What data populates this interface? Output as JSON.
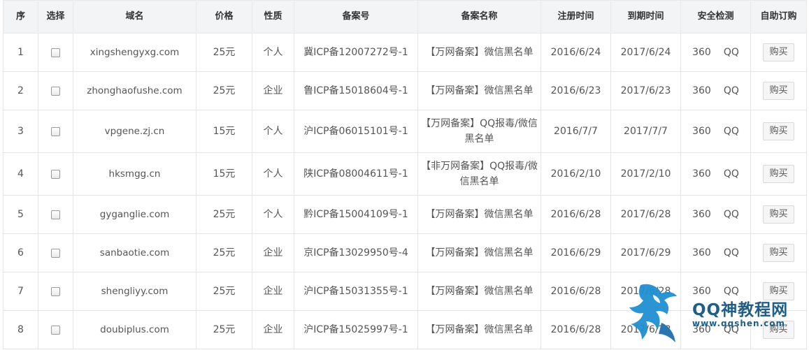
{
  "table": {
    "headers": [
      "序",
      "选择",
      "域名",
      "价格",
      "性质",
      "备案号",
      "备案名称",
      "注册时间",
      "到期时间",
      "安全检测",
      "自助订购"
    ],
    "rows": [
      {
        "no": "1",
        "domain": "xingshengyxg.com",
        "price": "25元",
        "type": "个人",
        "icp": "冀ICP备12007272号-1",
        "name": "【万网备案】微信黑名单",
        "reg": "2016/6/24",
        "exp": "2017/6/24",
        "check_a": "360",
        "check_b": "QQ",
        "buy": "购买"
      },
      {
        "no": "2",
        "domain": "zhonghaofushe.com",
        "price": "25元",
        "type": "企业",
        "icp": "鲁ICP备15018604号-1",
        "name": "【万网备案】微信黑名单",
        "reg": "2016/6/23",
        "exp": "2017/6/23",
        "check_a": "360",
        "check_b": "QQ",
        "buy": "购买"
      },
      {
        "no": "3",
        "domain": "vpgene.zj.cn",
        "price": "15元",
        "type": "个人",
        "icp": "沪ICP备06015101号-1",
        "name": "【万网备案】QQ报毒/微信黑名单",
        "reg": "2016/7/7",
        "exp": "2017/7/7",
        "check_a": "360",
        "check_b": "QQ",
        "buy": "购买"
      },
      {
        "no": "4",
        "domain": "hksmgg.cn",
        "price": "15元",
        "type": "个人",
        "icp": "陕ICP备08004611号-1",
        "name": "【非万网备案】QQ报毒/微信黑名单",
        "reg": "2016/2/10",
        "exp": "2017/2/10",
        "check_a": "360",
        "check_b": "QQ",
        "buy": "购买"
      },
      {
        "no": "5",
        "domain": "gyganglie.com",
        "price": "25元",
        "type": "个人",
        "icp": "黔ICP备15004109号-1",
        "name": "【万网备案】微信黑名单",
        "reg": "2016/6/28",
        "exp": "2017/6/28",
        "check_a": "360",
        "check_b": "QQ",
        "buy": "购买"
      },
      {
        "no": "6",
        "domain": "sanbaotie.com",
        "price": "25元",
        "type": "企业",
        "icp": "京ICP备13029950号-4",
        "name": "【万网备案】微信黑名单",
        "reg": "2016/6/29",
        "exp": "2017/6/29",
        "check_a": "360",
        "check_b": "QQ",
        "buy": "购买"
      },
      {
        "no": "7",
        "domain": "shengliyy.com",
        "price": "25元",
        "type": "企业",
        "icp": "沪ICP备15031355号-1",
        "name": "【万网备案】微信黑名单",
        "reg": "2016/6/28",
        "exp": "2017/6/28",
        "check_a": "360",
        "check_b": "QQ",
        "buy": "购买"
      },
      {
        "no": "8",
        "domain": "doubiplus.com",
        "price": "25元",
        "type": "企业",
        "icp": "沪ICP备15025997号-1",
        "name": "【万网备案】微信黑名单",
        "reg": "2016/6/28",
        "exp": "2017/6/28",
        "check_a": "360",
        "check_b": "QQ",
        "buy": "购买"
      }
    ]
  },
  "watermark": {
    "title": "QQ神教程网",
    "url": "www.qqshen.com"
  },
  "colors": {
    "header_bg": "#f3f4f6",
    "border": "#e4e4e4",
    "text": "#555555",
    "watermark": "#1f5e87"
  }
}
